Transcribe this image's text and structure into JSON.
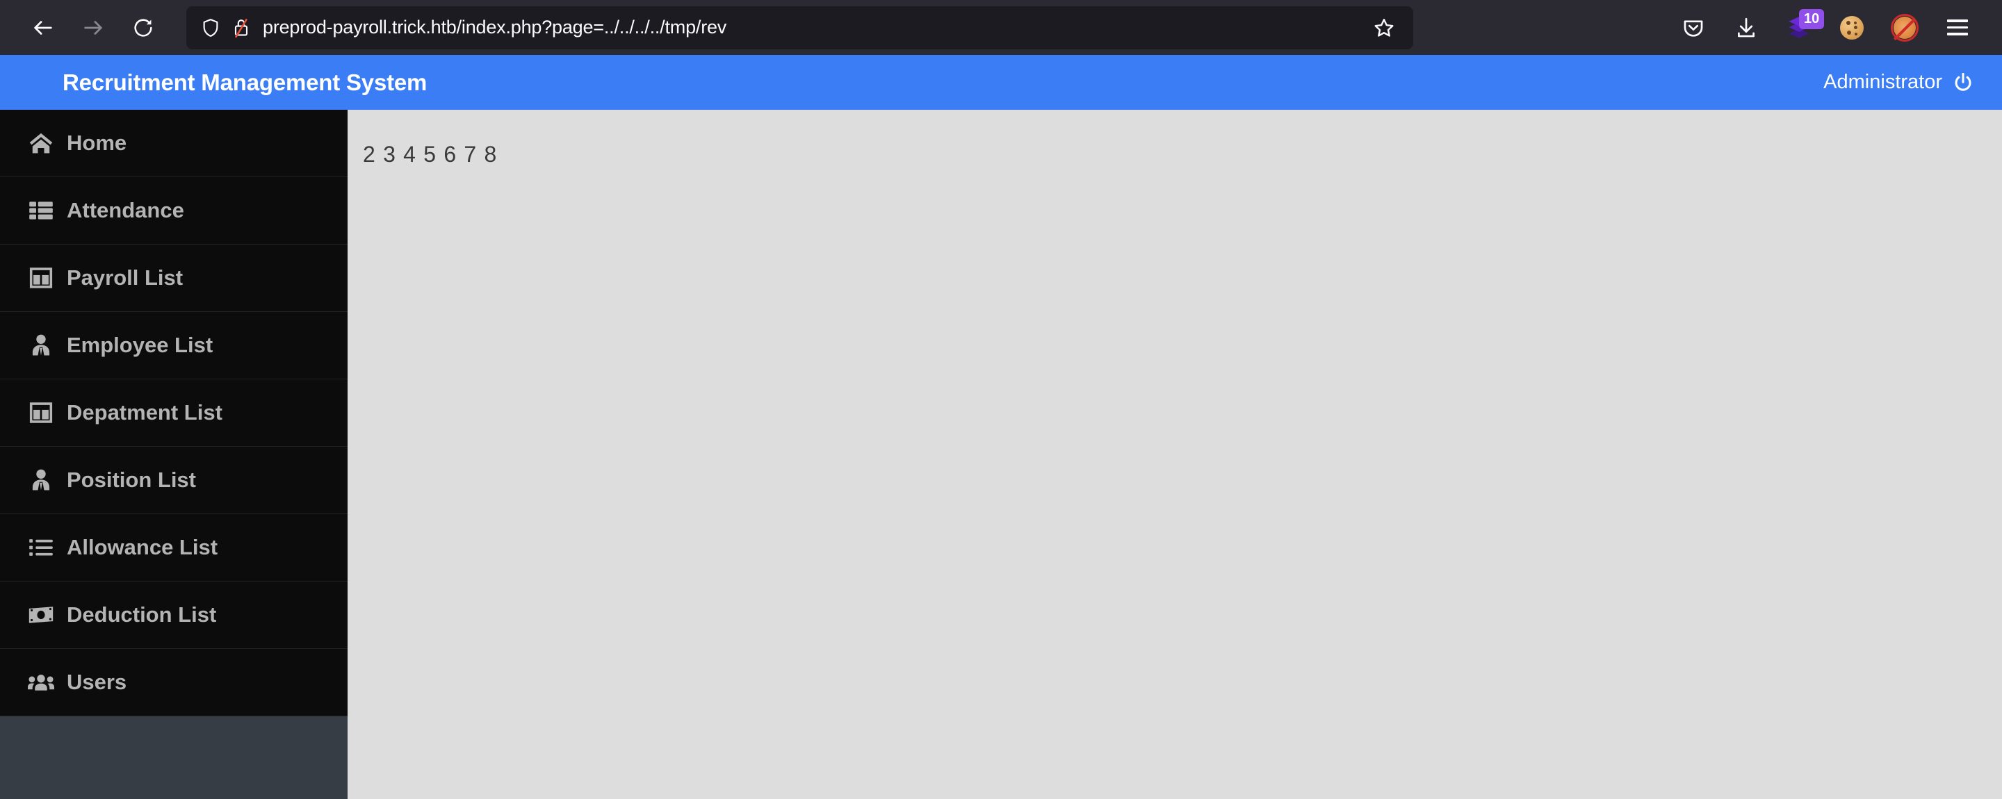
{
  "browser": {
    "back_label": "Back",
    "forward_label": "Forward",
    "reload_label": "Reload",
    "url": "preprod-payroll.trick.htb/index.php?page=../../../../tmp/rev",
    "url_placeholder": "Search with Google or enter address",
    "shield_icon": "shield-icon",
    "insecure_icon": "broken-lock-icon",
    "bookmark_icon": "star-icon",
    "toolbar": [
      {
        "name": "pocket-icon",
        "label": "Save to Pocket"
      },
      {
        "name": "download-icon",
        "label": "Downloads"
      },
      {
        "name": "extension-layers-icon",
        "label": "Extension",
        "badge": "10"
      },
      {
        "name": "cookie-icon",
        "label": "Cookie Manager"
      },
      {
        "name": "fox-blocked-icon",
        "label": "Disabled Extension"
      },
      {
        "name": "hamburger-menu-icon",
        "label": "Open application menu"
      }
    ],
    "chrome_bg": "#2b2a33",
    "urlbar_bg": "#1c1b22"
  },
  "app": {
    "title": "Recruitment Management System",
    "user": "Administrator",
    "logout_icon": "power-icon",
    "header_color": "#3b7df5",
    "sidebar_color": "#0c0c0c",
    "content_color": "#dddddd"
  },
  "sidebar": {
    "items": [
      {
        "label": "Home",
        "icon": "home-icon"
      },
      {
        "label": "Attendance",
        "icon": "th-list-icon"
      },
      {
        "label": "Payroll List",
        "icon": "columns-icon"
      },
      {
        "label": "Employee List",
        "icon": "user-tie-icon"
      },
      {
        "label": "Depatment List",
        "icon": "columns-icon"
      },
      {
        "label": "Position List",
        "icon": "user-tie-icon"
      },
      {
        "label": "Allowance List",
        "icon": "list-ul-icon"
      },
      {
        "label": "Deduction List",
        "icon": "money-bill-icon"
      },
      {
        "label": "Users",
        "icon": "users-icon"
      }
    ]
  },
  "main": {
    "output": "2 3 4 5 6 7 8"
  }
}
